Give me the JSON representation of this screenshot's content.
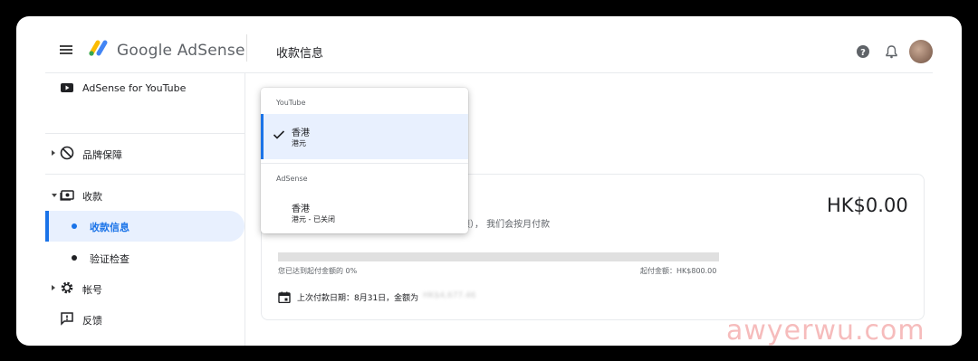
{
  "header": {
    "brand": "Google AdSense",
    "page_title": "收款信息"
  },
  "sidebar": {
    "items": [
      {
        "label": "AdSense for YouTube",
        "icon": "youtube-icon"
      },
      {
        "label": "品牌保障",
        "icon": "block-icon"
      },
      {
        "label": "收款",
        "icon": "payments-icon"
      },
      {
        "label": "收款信息",
        "active": true
      },
      {
        "label": "验证检查"
      },
      {
        "label": "帐号",
        "icon": "gear-icon"
      },
      {
        "label": "反馈",
        "icon": "feedback-icon"
      }
    ]
  },
  "dropdown": {
    "group1": "YouTube",
    "selected": {
      "title": "香港",
      "subtitle": "港元"
    },
    "group2": "AdSense",
    "option2": {
      "title": "香港",
      "subtitle": "港元 - 已关闭"
    }
  },
  "card": {
    "amount": "HK$0.00",
    "partial_text": "额）， 我们会按月付款",
    "progress_percent": 0,
    "progress_left": "您已达到起付金额的 0%",
    "progress_right": "起付金额：HK$800.00",
    "last_payment": "上次付款日期：8月31日，金额为",
    "last_payment_amount": "HK$4,677.46"
  },
  "watermark": "awyerwu.com",
  "colors": {
    "accent": "#1a73e8",
    "selected_bg": "#e8f0fe"
  }
}
